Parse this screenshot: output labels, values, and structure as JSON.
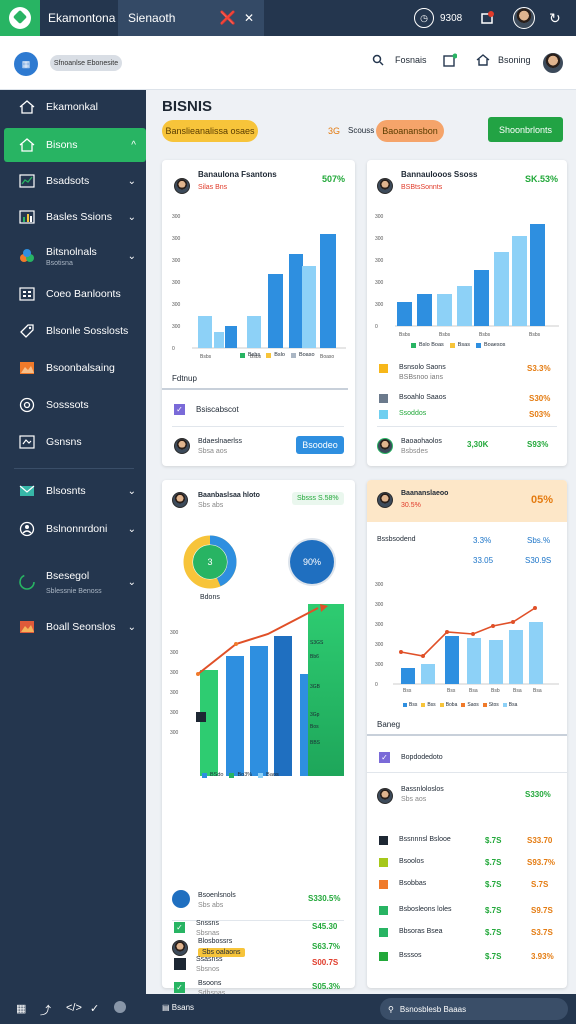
{
  "topbar": {
    "tab1": "Ekamontona",
    "tab2": "Sienaoth",
    "right_label": "9308"
  },
  "header": {
    "chip": "Sfnoanlse Ebonesite",
    "search_label": "Fosnais",
    "nav2_label": "Bsoning"
  },
  "sidebar": {
    "items": [
      {
        "label": "Ekamonkal",
        "icon": "home-icon"
      },
      {
        "label": "Bisons",
        "icon": "home-icon",
        "active": true
      },
      {
        "label": "Bsadsots",
        "icon": "chart-icon"
      },
      {
        "label": "Basles Ssions",
        "icon": "bar-chart-icon"
      },
      {
        "label": "Bitsnolnals",
        "sub": "Bsotisna",
        "icon": "palette-icon"
      },
      {
        "label": "Coeo Banloonts",
        "icon": "grid-icon"
      },
      {
        "label": "Blsonle Sosslosts",
        "icon": "tag-icon"
      },
      {
        "label": "Bsoonbalsaing",
        "icon": "image-icon"
      },
      {
        "label": "Sosssots",
        "icon": "support-icon"
      },
      {
        "label": "Gsnsns",
        "icon": "device-icon"
      },
      {
        "label": "Blsosnts",
        "icon": "mail-icon"
      },
      {
        "label": "Bslnonnrdoni",
        "icon": "people-icon"
      },
      {
        "label": "Bsesegol",
        "sub": "Sblessnie Benoss",
        "icon": "loader-icon"
      },
      {
        "label": "Boall Seonslos",
        "icon": "photo-icon"
      }
    ]
  },
  "page": {
    "title": "BISNIS",
    "pill1": "Banslieanalissa osaes",
    "pill2_prefix": "3G",
    "pill2_mid": "Scouss",
    "pill3": "Baoanansbon",
    "action_button": "Shoonbrlonts"
  },
  "card1": {
    "title": "Banaulona Fsantons",
    "subtitle": "Silas Bns",
    "badge": "507%",
    "legend": [
      "Bsbs",
      "Bslo",
      "Boaso"
    ],
    "section": "Fdtnup",
    "row1": "Bsiscabscot",
    "row2_title": "Bdaeslnaerlss",
    "row2_sub": "Sbsa aos",
    "row2_btn": "Bsoodeo"
  },
  "card2": {
    "title": "Bannaulooos Ssoss",
    "subtitle": "BSBtsSonnts",
    "badge": "SK.53%",
    "legend": [
      "Bslo Boas",
      "Bsas",
      "Boaesos"
    ],
    "rows": [
      {
        "title": "Bsnsolo Saons",
        "sub": "BSBsnoo ians",
        "value": "S3.3%"
      },
      {
        "title": "Bsoahlo Saaos",
        "sub": "",
        "value": "S30%"
      },
      {
        "title": "Ssoddos",
        "sub": "",
        "value": "S03%"
      }
    ],
    "footer_title": "Baoaohaolos",
    "footer_sub": "Bsbsdes",
    "footer_mid": "3,30K",
    "footer_value": "S93%"
  },
  "card3": {
    "title": "Baanbaslsaa hloto",
    "subtitle": "Sbs abs",
    "badge": "Sbsss S.58%",
    "donut1_value": "3",
    "donut1_label": "Bdons",
    "donut2_value": "90%",
    "chart_labels": [
      "S3GS",
      "Bb6",
      "3GB",
      "3Gp",
      "Bos",
      "BBS"
    ],
    "legend": [
      "BSdo",
      "Bo3%",
      "Baos"
    ],
    "rows": [
      {
        "title": "Bsoenlsnols",
        "sub": "Sbs abs",
        "value": "S330.5%"
      },
      {
        "title": "Blosbossrs",
        "sub": "Sbs oalaons",
        "value": "S63.7%"
      },
      {
        "title": "Bsoons",
        "sub": "Sdbsnas",
        "value": "S05.3%"
      },
      {
        "title": "Snssns",
        "sub": "Sbsnas",
        "value": "S45.30"
      },
      {
        "title": "Ssasnss",
        "sub": "Sbsnos",
        "value": "S00.7S"
      }
    ]
  },
  "card4": {
    "title": "Baananslaeoo",
    "subtitle": "30.5%",
    "badge": "05%",
    "label": "Bssbsodend",
    "v1": "3.3%",
    "v2": "Sbs.%",
    "v3": "33.05",
    "v4": "S30.9S",
    "legend": [
      "Bss",
      "Bss",
      "Boba",
      "Saos",
      "Stos",
      "Bsa",
      "Bosa"
    ],
    "section": "Baneg",
    "row1": "Bopdodedoto",
    "person_title": "Bassnloloslos",
    "person_sub": "Sbs aos",
    "person_value": "S330%",
    "rows": [
      {
        "title": "Bssnnnsl Bslooe",
        "mid": "$.7S",
        "value": "S33.70"
      },
      {
        "title": "Bsoolos",
        "mid": "$.7S",
        "value": "S93.7%"
      },
      {
        "title": "Bsobbas",
        "mid": "$.7S",
        "value": "S.7S"
      },
      {
        "title": "Bsbosleons loles",
        "mid": "$.7S",
        "value": "S9.7S"
      },
      {
        "title": "Bbsoras Bsea",
        "mid": "$.7S",
        "value": "S3.7S"
      },
      {
        "title": "Bsssos",
        "mid": "$.7S",
        "value": "3.93%"
      }
    ]
  },
  "bottombar": {
    "label": "Bsans",
    "search_text": "Bsnosblesb Baaas"
  },
  "colors": {
    "sidebar": "#24364e",
    "accent_green": "#28b463",
    "bar_blue": "#2e8fe0",
    "bar_light": "#8dd1f7",
    "pill_yellow": "#f7c43a",
    "pill_orange": "#f5a46a",
    "line_red": "#e05028"
  }
}
